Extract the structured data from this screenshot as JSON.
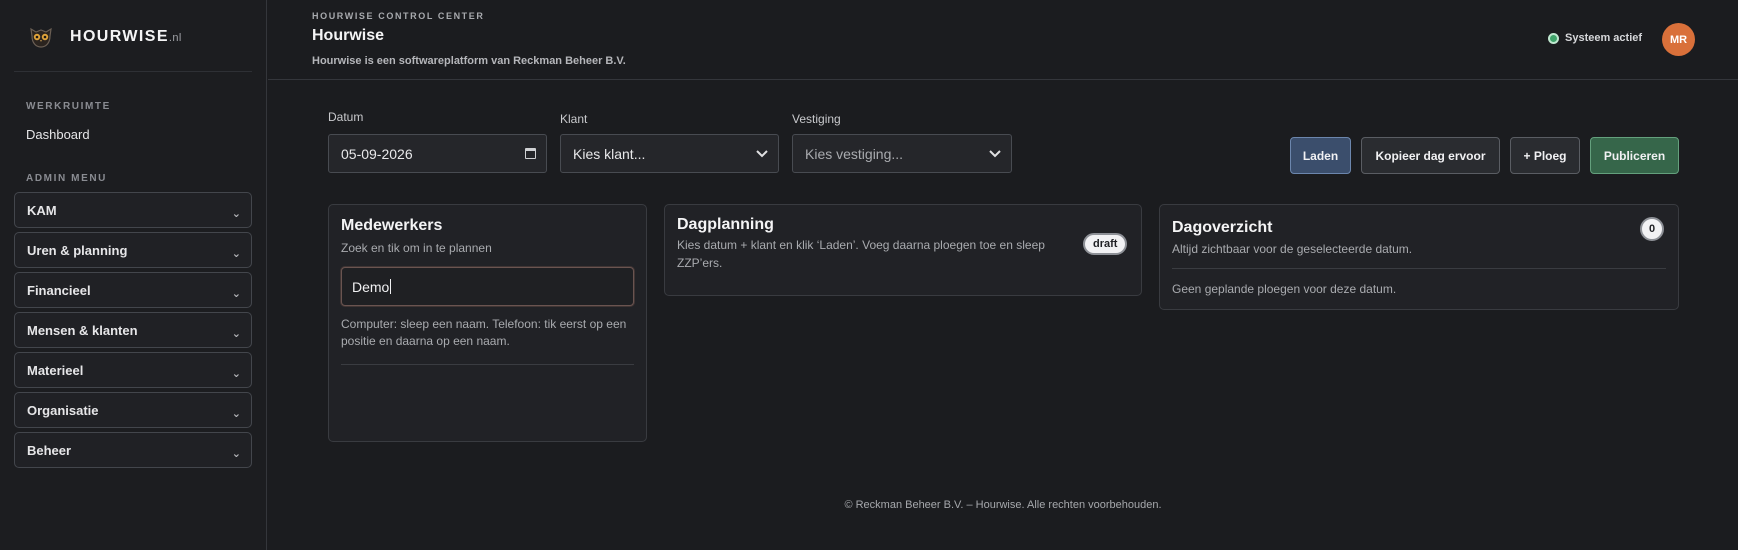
{
  "brand": {
    "name": "HOURWISE",
    "tld": ".nl"
  },
  "sidebar": {
    "workspace_label": "WERKRUIMTE",
    "dashboard_label": "Dashboard",
    "admin_label": "ADMIN MENU",
    "items": [
      {
        "label": "KAM"
      },
      {
        "label": "Uren & planning"
      },
      {
        "label": "Financieel"
      },
      {
        "label": "Mensen & klanten"
      },
      {
        "label": "Materieel"
      },
      {
        "label": "Organisatie"
      },
      {
        "label": "Beheer"
      }
    ],
    "chevron": "⌄"
  },
  "header": {
    "eyebrow": "HOURWISE CONTROL CENTER",
    "title": "Hourwise",
    "subtitle": "Hourwise is een softwareplatform van Reckman Beheer B.V.",
    "status": "Systeem actief",
    "status_color": "#3fa46a",
    "avatar_initials": "MR",
    "avatar_color": "#d9703a"
  },
  "filters": {
    "date_label": "Datum",
    "date_value": "05-09-2026",
    "client_label": "Klant",
    "client_value": "Kies klant...",
    "location_label": "Vestiging",
    "location_value": "Kies vestiging..."
  },
  "actions": {
    "load": "Laden",
    "copy_prev": "Kopieer dag ervoor",
    "add_shift": "+ Ploeg",
    "publish": "Publiceren"
  },
  "employees": {
    "title": "Medewerkers",
    "subtitle": "Zoek en tik om in te plannen",
    "search_value": "Demo",
    "hint": "Computer: sleep een naam. Telefoon: tik eerst op een positie en daarna op een naam."
  },
  "day_planning": {
    "title": "Dagplanning",
    "description": "Kies datum + klant en klik ‘Laden’. Voeg daarna ploegen toe en sleep ZZP’ers.",
    "badge": "draft"
  },
  "day_overview": {
    "title": "Dagoverzicht",
    "subtitle": "Altijd zichtbaar voor de geselecteerde datum.",
    "count": "0",
    "empty": "Geen geplande ploegen voor deze datum."
  },
  "footer": {
    "text": "© Reckman Beheer B.V. – Hourwise. Alle rechten voorbehouden."
  }
}
